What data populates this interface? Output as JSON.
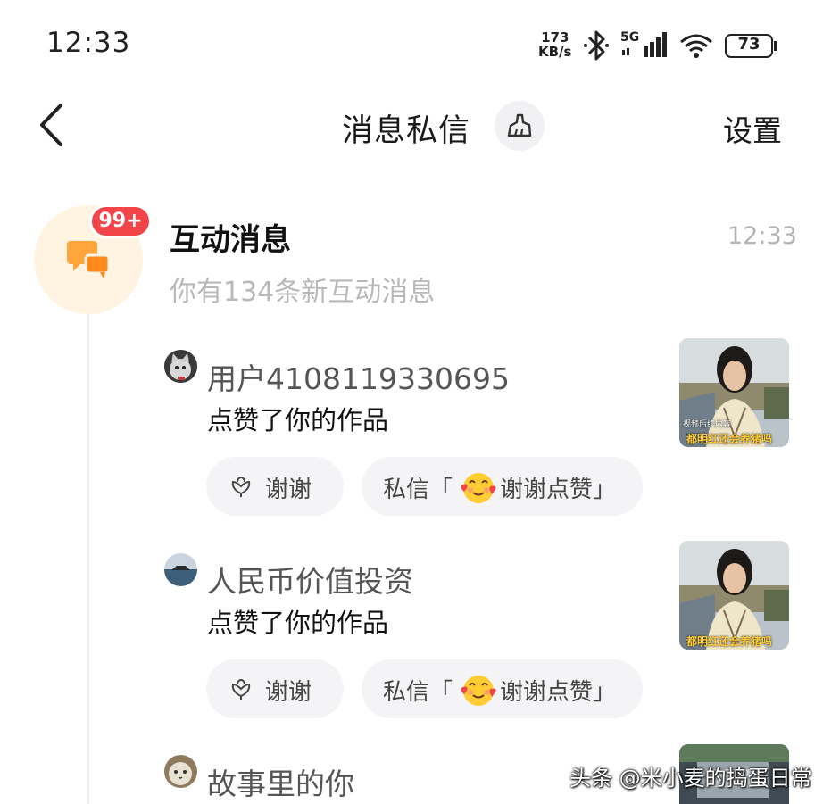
{
  "status_bar": {
    "time": "12:33",
    "net_speed_value": "173",
    "net_speed_unit": "KB/s",
    "network": "5G",
    "battery": "73"
  },
  "nav": {
    "title": "消息私信",
    "settings_label": "设置"
  },
  "interaction": {
    "title": "互动消息",
    "badge": "99+",
    "time": "12:33",
    "subtitle": "你有134条新互动消息",
    "accent": "#f2454a",
    "icon_color": "#ffa53c"
  },
  "items": [
    {
      "user": "用户4108119330695",
      "action": "点赞了你的作品",
      "thanks_label": "谢谢",
      "dm_prefix": "私信「",
      "dm_suffix": "谢谢点赞」",
      "thumb_caption": "都明红还会养猪吗",
      "thumb_overlay": "视频后续内容"
    },
    {
      "user": "人民币价值投资",
      "action": "点赞了你的作品",
      "thanks_label": "谢谢",
      "dm_prefix": "私信「",
      "dm_suffix": "谢谢点赞」",
      "thumb_caption": "都明红还会养猪吗"
    },
    {
      "user": "故事里的你"
    }
  ],
  "watermark": "头条 @米小麦的捣蛋日常"
}
